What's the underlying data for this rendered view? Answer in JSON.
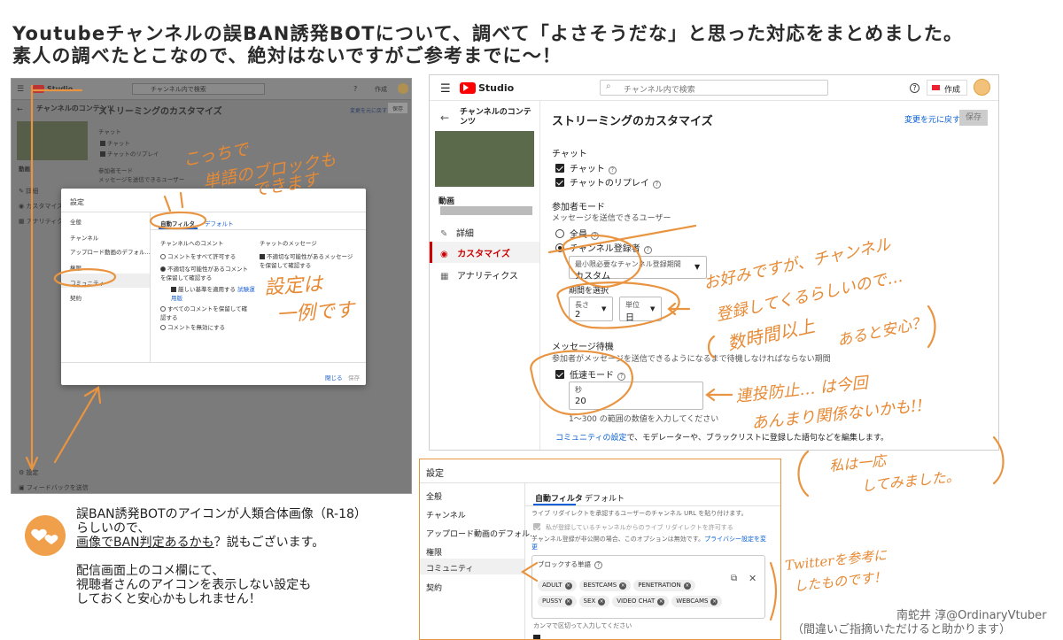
{
  "headline": {
    "line1": "Youtubeチャンネルの誤BAN誘発BOTについて、調べて「よさそうだな」と思った対応をまとめました。",
    "line2": "素人の調べたとこなので、絶対はないですがご参考までに〜！"
  },
  "left_shot": {
    "studio_logo": "Studio",
    "search_placeholder": "チャンネル内で検索",
    "create_label": "作成",
    "sidebar_title": "チャンネルのコンテンツ",
    "main_title": "ストリーミングのカスタマイズ",
    "undo_label": "変更を元に戻す",
    "save_label": "保存",
    "chat_label": "チャット",
    "chat_item": "チャット",
    "chat_replay": "チャットのリプレイ",
    "video_label": "動画",
    "detail_label": "詳細",
    "customize_label": "カスタマイズ",
    "analytics_label": "アナリティクス",
    "participant_mode": "参加者モード",
    "participant_desc": "メッセージを送信できるユーザー",
    "settings_label": "設定",
    "feedback_label": "フィードバックを送信",
    "dialog": {
      "title": "設定",
      "nav": [
        "全般",
        "チャンネル",
        "アップロード動画のデフォル...",
        "権限",
        "コミュニティ",
        "契約"
      ],
      "tabs": [
        "自動フィルタ",
        "デフォルト"
      ],
      "comments_heading": "チャンネルへのコメント",
      "comment_opts": [
        "コメントをすべて許可する",
        "不適切な可能性があるコメントを保留して確認する",
        "厳しい基準を適用する",
        "すべてのコメントを保留して確認する",
        "コメントを無効にする"
      ],
      "beta_label": "試験運用版",
      "chat_heading": "チャットのメッセージ",
      "chat_opt": "不適切な可能性があるメッセージを保留して確認する",
      "close_label": "閉じる",
      "save_label": "保存"
    }
  },
  "right_shot": {
    "studio_logo": "Studio",
    "search_placeholder": "チャンネル内で検索",
    "create_label": "作成",
    "sidebar_title": "チャンネルのコンテンツ",
    "video_label": "動画",
    "nav_details": "詳細",
    "nav_customize": "カスタマイズ",
    "nav_analytics": "アナリティクス",
    "main_title": "ストリーミングのカスタマイズ",
    "undo_label": "変更を元に戻す",
    "save_label": "保存",
    "chat_heading": "チャット",
    "chat_item": "チャット",
    "chat_replay": "チャットのリプレイ",
    "participant_heading": "参加者モード",
    "participant_desc": "メッセージを送信できるユーザー",
    "everyone": "全員",
    "subscribers": "チャンネル登録者",
    "min_period_label": "最小限必要なチャンネル登録期間",
    "min_period_value": "カスタム",
    "period_select": "期間を選択",
    "length_label": "長さ",
    "length_value": "2",
    "unit_label": "単位",
    "unit_value": "日",
    "wait_heading": "メッセージ待機",
    "wait_desc": "参加者がメッセージを送信できるようになるまで待機しなければならない期間",
    "slow_mode": "低速モード",
    "seconds_label": "秒",
    "seconds_value": "20",
    "range_hint": "1〜300 の範囲の数値を入力してください",
    "community_link": "コミュニティの設定",
    "community_desc": "で、モデレーターや、ブラックリストに登録した語句などを編集します。"
  },
  "bottom_shot": {
    "title": "設定",
    "nav": [
      "全般",
      "チャンネル",
      "アップロード動画のデフォル...",
      "権限",
      "コミュニティ",
      "契約"
    ],
    "tabs": [
      "自動フィルタ",
      "デフォルト"
    ],
    "line1": "ライブ リダイレクトを承認するユーザーのチャンネル URL を貼り付けます。",
    "line2": "私が登録しているチャンネルからのライブ リダイレクトを許可する",
    "line3": "チャンネル登録が非公開の場合、このオプションは無効です。",
    "privacy_link": "プライバシー設定を変更",
    "blocked_heading": "ブロックする単語",
    "blocked_words": [
      "ADULT",
      "BESTCAMS",
      "PENETRATION",
      "PUSSY",
      "SEX",
      "VIDEO CHAT",
      "WEBCAMS"
    ],
    "comma_hint": "カンマで区切って入力してください"
  },
  "annotations": {
    "a1_line1": "こっちで",
    "a1_line2": "単語のブロックも",
    "a1_line3": "できます",
    "a2_line1": "設定は",
    "a2_line2": "一例です",
    "a3_line1": "お好みですが、チャンネル",
    "a3_line2": "登録してくるらしいので…",
    "a3_line3": "数時間以上",
    "a3_line4": "あると安心？",
    "a4_line1": "連投防止… は今回",
    "a4_line2": "あんまり関係ないかも!!",
    "a5_line1": "私は一応",
    "a5_line2": "してみました。",
    "a6_line1": "Twitterを参考に",
    "a6_line2": "したものです！"
  },
  "notes": {
    "line1": "誤BAN誘発BOTのアイコンが人類合体画像（R-18）",
    "line2": "らしいので、",
    "line3_underlined": "画像でBAN判定あるかも",
    "line3_rest": "？説もございます。",
    "line4": "配信画面上のコメ欄にて、",
    "line5": "視聴者さんのアイコンを表示しない設定も",
    "line6": "しておくと安心かもしれません！"
  },
  "credit": {
    "line1": "南蛇井 淳@OrdinaryVtuber",
    "line2": "（間違いご指摘いただけると助かります）"
  },
  "colors": {
    "accent_orange": "#e99440",
    "youtube_red": "#ff0000",
    "link_blue": "#065fd4"
  }
}
